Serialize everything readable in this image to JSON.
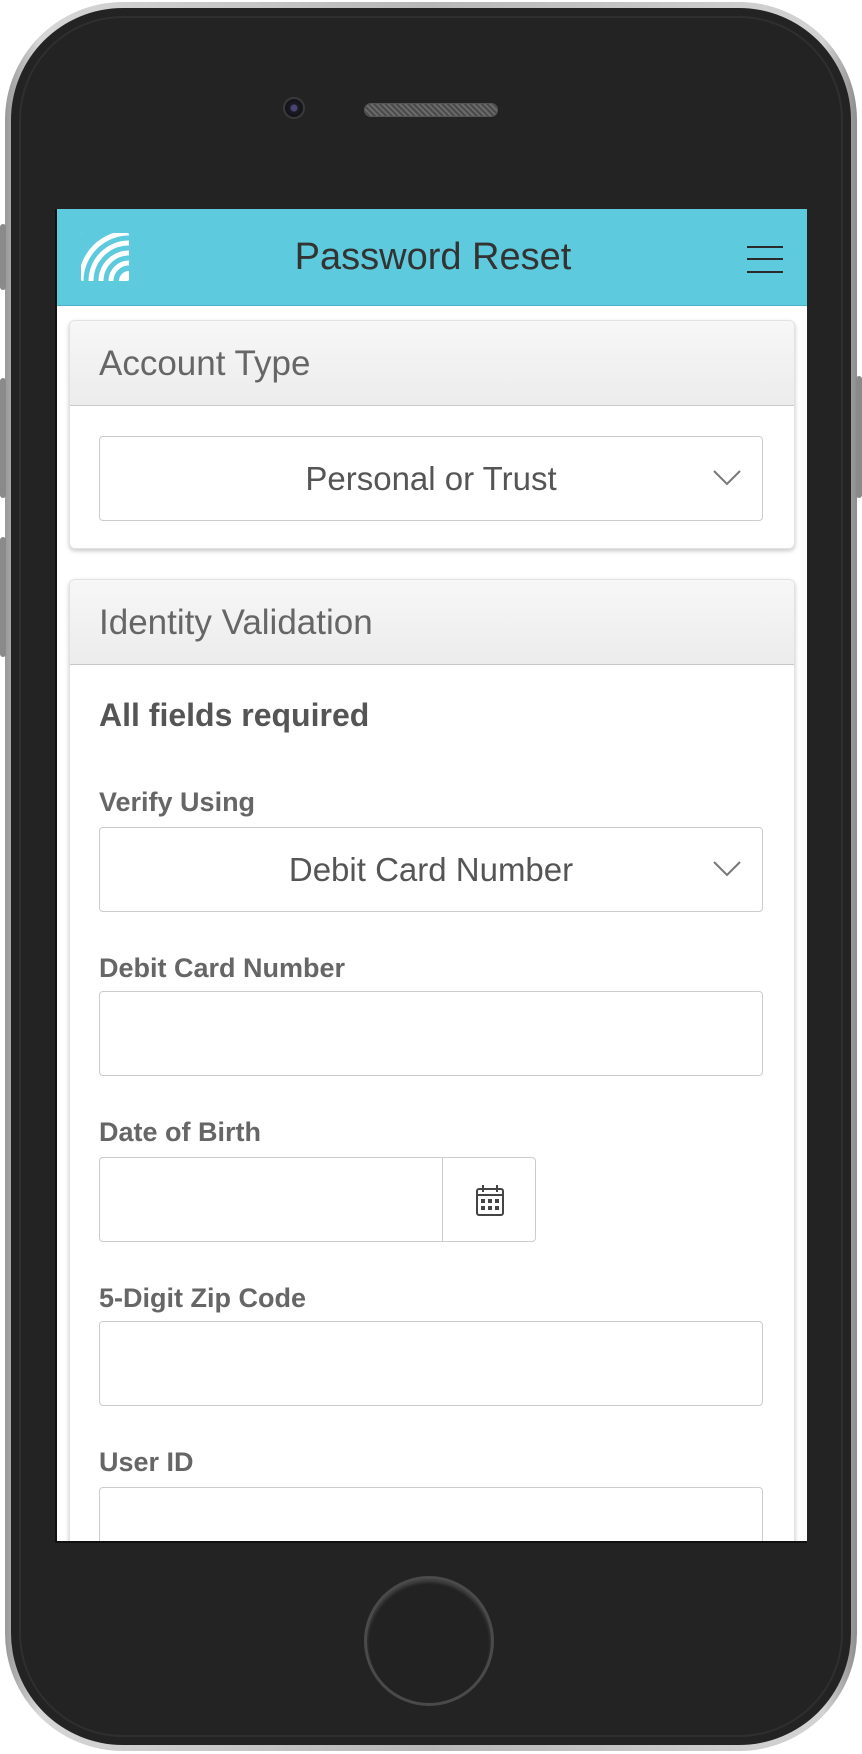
{
  "header": {
    "title": "Password Reset",
    "logo_icon": "rainbow-arcs-logo-icon",
    "menu_icon": "hamburger-menu-icon",
    "background_color": "#5ecadd"
  },
  "account_panel": {
    "heading": "Account Type",
    "account_type_select": {
      "selected": "Personal or Trust",
      "icon": "chevron-down-icon"
    }
  },
  "identity_panel": {
    "heading": "Identity Validation",
    "required_note": "All fields required",
    "verify_using": {
      "label": "Verify Using",
      "selected": "Debit Card Number",
      "icon": "chevron-down-icon"
    },
    "debit_card": {
      "label": "Debit Card Number",
      "value": ""
    },
    "date_of_birth": {
      "label": "Date of Birth",
      "value": "",
      "icon": "calendar-icon"
    },
    "zip_code": {
      "label": "5-Digit Zip Code",
      "value": ""
    },
    "user_id": {
      "label": "User ID",
      "value": ""
    }
  }
}
